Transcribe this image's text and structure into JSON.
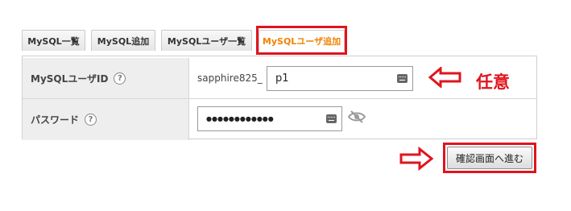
{
  "tabs": [
    {
      "label": "MySQL一覧",
      "active": false
    },
    {
      "label": "MySQL追加",
      "active": false
    },
    {
      "label": "MySQLユーザ一覧",
      "active": false
    },
    {
      "label": "MySQLユーザ追加",
      "active": true
    }
  ],
  "form": {
    "user_id": {
      "label": "MySQLユーザID",
      "help": "?",
      "prefix": "sapphire825_",
      "value": "p1"
    },
    "password": {
      "label": "パスワード",
      "help": "?",
      "masked_value": "●●●●●●●●●●●●"
    }
  },
  "annotation": {
    "note": "任意",
    "color": "#e0141e"
  },
  "confirm_button": {
    "label": "確認画面へ進む"
  },
  "colors": {
    "active_tab_text": "#f08300",
    "highlight": "#e0141e",
    "label_background": "#eeeeee"
  }
}
